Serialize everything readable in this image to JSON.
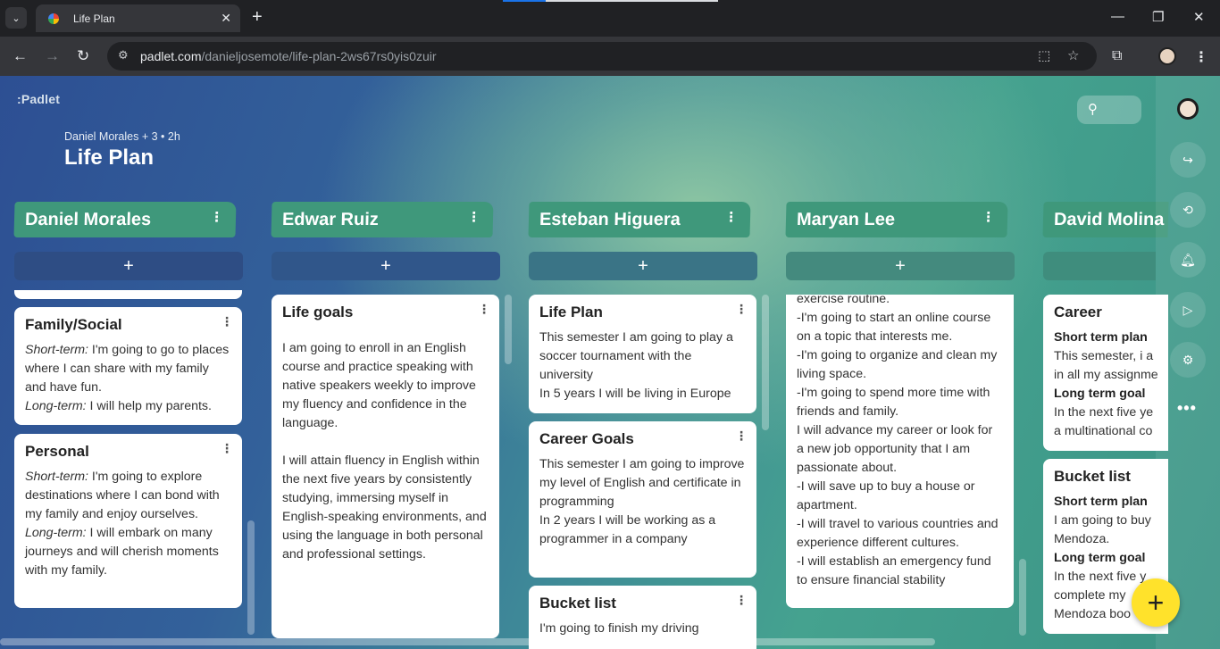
{
  "browser": {
    "tab_title": "Life Plan",
    "url_domain": "padlet.com",
    "url_path": "/danieljosemote/life-plan-2ws67rs0yis0zuir"
  },
  "padlet": {
    "logo": ":Padlet",
    "meta": "Daniel Morales + 3 • 2h",
    "title": "Life Plan",
    "add_label": "+",
    "fab_label": "+"
  },
  "columns": [
    {
      "name": "Daniel Morales",
      "cards": [
        {
          "title": "Family/Social",
          "short_label": "Short-term:",
          "short": " I'm going to go to places where I can share with my family and have fun.",
          "long_label": "Long-term:",
          "long": " I will help my parents."
        },
        {
          "title": "Personal",
          "short_label": "Short-term:",
          "short": " I'm going to explore destinations where I can bond with my family and enjoy ourselves.",
          "long_label": "Long-term:",
          "long": " I will embark on many journeys and will cherish moments with my family."
        }
      ]
    },
    {
      "name": "Edwar Ruiz",
      "cards": [
        {
          "title": "Life goals",
          "p1": "I am going to enroll in an English course and practice speaking with native speakers weekly to improve my fluency and confidence in the language.",
          "p2": "I will attain fluency in English within the next five years by consistently studying, immersing myself in English-speaking environments, and using the language in both personal and professional settings."
        }
      ]
    },
    {
      "name": "Esteban Higuera",
      "cards": [
        {
          "title": "Life Plan",
          "l1": "This semester I am going to play a soccer tournament with the university",
          "l2": "In 5 years I will be living in Europe"
        },
        {
          "title": "Career Goals",
          "l1": "This semester I am going to improve my level of English and certificate in programming",
          "l2": "In 2 years I will be working as a programmer in a company"
        },
        {
          "title": "Bucket list",
          "l1": "I'm going to finish my driving"
        }
      ]
    },
    {
      "name": "Maryan Lee",
      "cards": [
        {
          "lines": [
            "exercise routine.",
            "-I'm going to start an online course on a topic that interests me.",
            "-I'm going to organize and clean my living space.",
            "-I'm going to spend more time with friends and family.",
            "I will advance my career or look for a new job opportunity that I am passionate about.",
            "-I will save up to buy a house or apartment.",
            "-I will travel to various countries and experience different cultures.",
            "-I will establish an emergency fund to ensure financial stability"
          ]
        }
      ]
    },
    {
      "name": "David Molina",
      "cards": [
        {
          "title": "Career",
          "s1": "Short term plan",
          "t1": "This semester, i a",
          "t1b": "in all my assignme",
          "s2": "Long term goal",
          "t2": "In the next five ye",
          "t2b": "a multinational co"
        },
        {
          "title": "Bucket list",
          "s1": "Short term plan",
          "t1": "I am going to buy",
          "t1b": "Mendoza.",
          "s2": "Long term goal",
          "t2": "In the next five y",
          "t2b": "complete my",
          "t2c": "Mendoza boo"
        }
      ]
    }
  ]
}
